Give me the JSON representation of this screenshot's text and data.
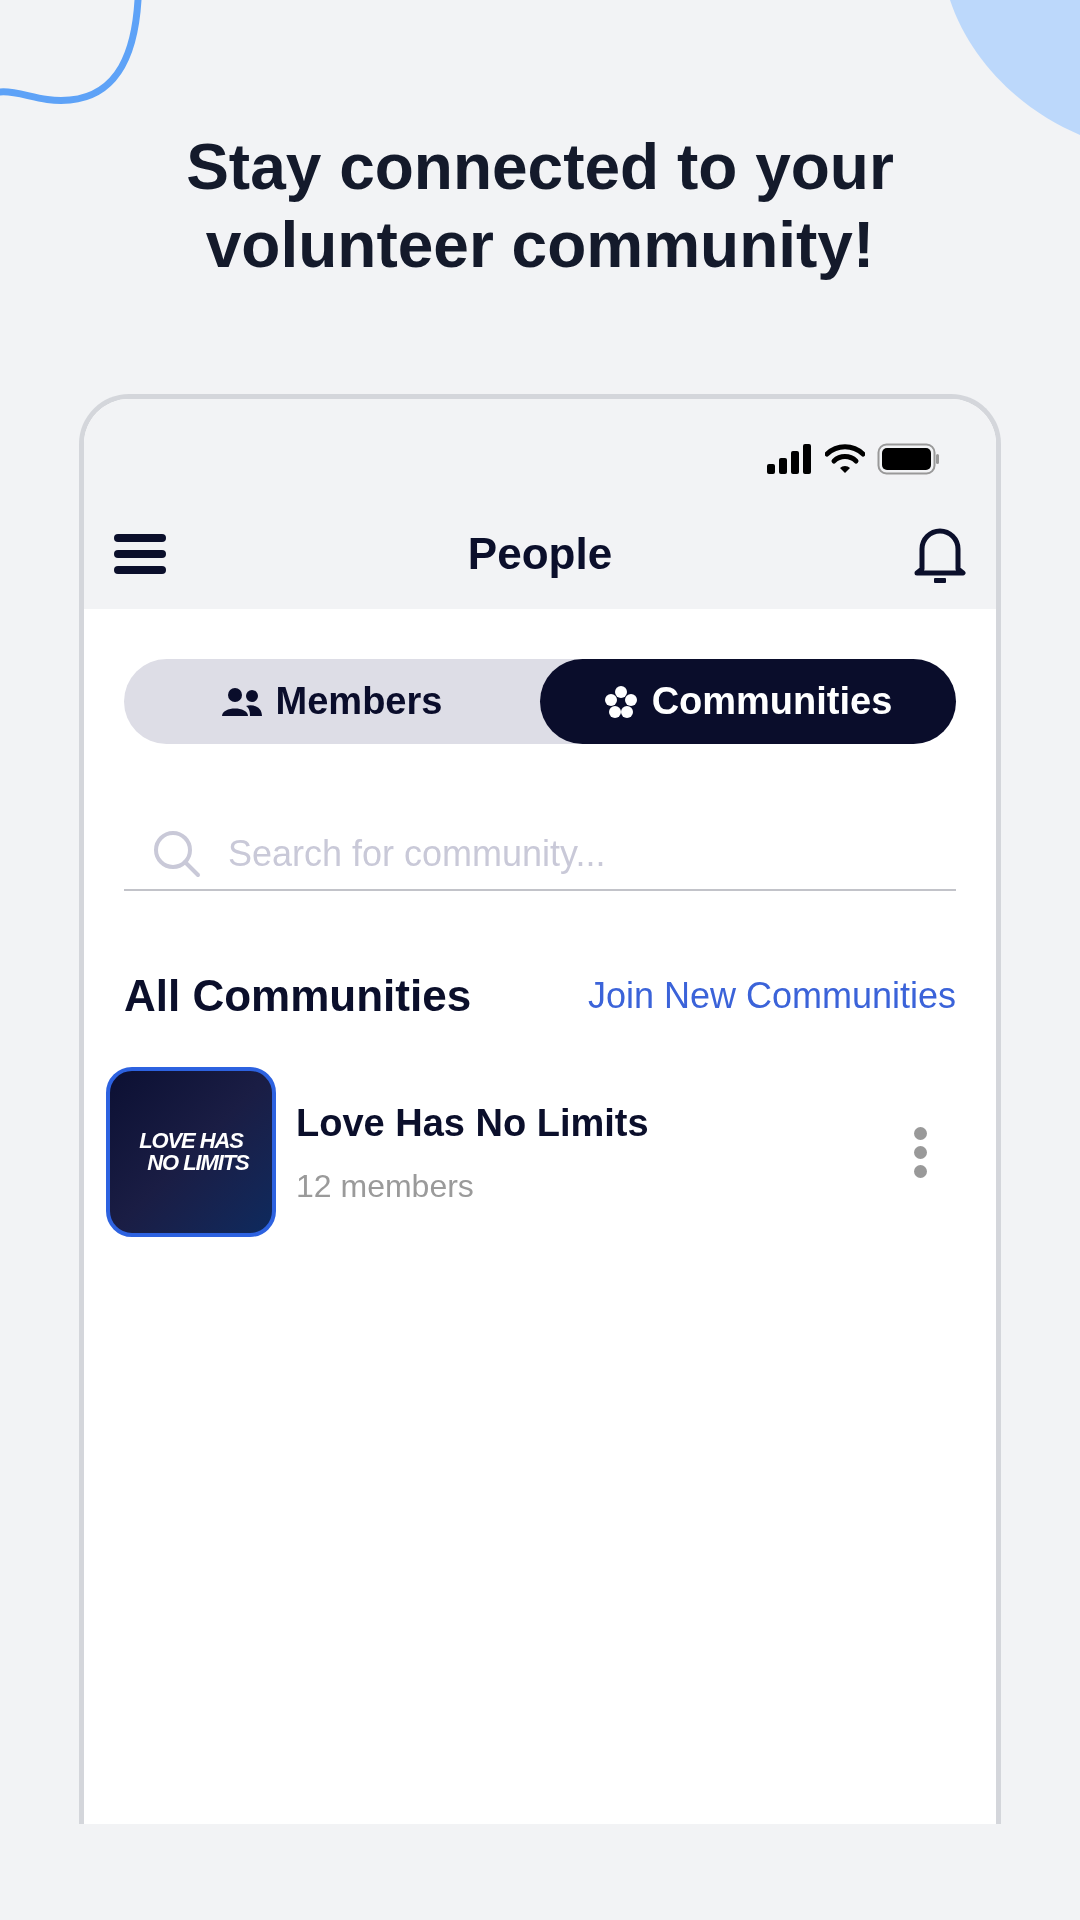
{
  "headline": "Stay connected to your volunteer community!",
  "app": {
    "title": "People",
    "tabs": [
      {
        "label": "Members",
        "selected": false
      },
      {
        "label": "Communities",
        "selected": true
      }
    ],
    "search": {
      "placeholder": "Search for community..."
    },
    "section": {
      "title": "All Communities",
      "link": "Join New Communities"
    },
    "communities": [
      {
        "logo_lines": [
          "LOVE HAS",
          "NO LIMITS"
        ],
        "name": "Love Has No Limits",
        "members": "12 members"
      }
    ]
  }
}
